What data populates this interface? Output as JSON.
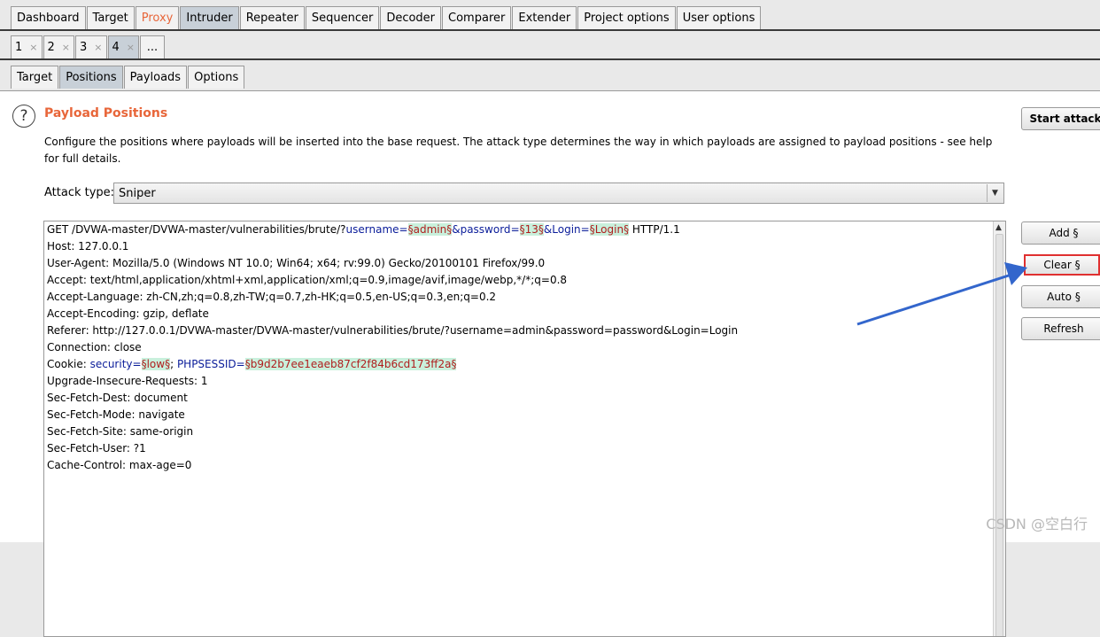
{
  "main_tabs": [
    "Dashboard",
    "Target",
    "Proxy",
    "Intruder",
    "Repeater",
    "Sequencer",
    "Decoder",
    "Comparer",
    "Extender",
    "Project options",
    "User options"
  ],
  "sub_tabs": [
    {
      "label": "1",
      "close": "×"
    },
    {
      "label": "2",
      "close": "×"
    },
    {
      "label": "3",
      "close": "×"
    },
    {
      "label": "4",
      "close": "×"
    }
  ],
  "sub_more": "...",
  "tool_tabs": [
    "Target",
    "Positions",
    "Payloads",
    "Options"
  ],
  "panel": {
    "title": "Payload Positions",
    "help": "?",
    "description": "Configure the positions where payloads will be inserted into the base request. The attack type determines the way in which payloads are assigned to payload positions - see help for full details.",
    "attack_label": "Attack type:",
    "attack_value": "Sniper",
    "dropdown_arrow": "▼"
  },
  "buttons": {
    "start": "Start attack",
    "add": "Add §",
    "clear": "Clear §",
    "auto": "Auto §",
    "refresh": "Refresh"
  },
  "request": {
    "line1": {
      "p1": "GET /DVWA-master/DVWA-master/vulnerabilities/brute/?",
      "k1": "username",
      "e1": "=",
      "m1": "§admin§",
      "amp1": "&",
      "k2": "password",
      "e2": "=",
      "m2": "§13§",
      "amp2": "&",
      "k3": "Login",
      "e3": "=",
      "m3": "§Login§",
      "tail": " HTTP/1.1"
    },
    "host": "Host: 127.0.0.1",
    "user_agent": "User-Agent: Mozilla/5.0 (Windows NT 10.0; Win64; x64; rv:99.0) Gecko/20100101 Firefox/99.0",
    "accept": "Accept: text/html,application/xhtml+xml,application/xml;q=0.9,image/avif,image/webp,*/*;q=0.8",
    "accept_language": "Accept-Language: zh-CN,zh;q=0.8,zh-TW;q=0.7,zh-HK;q=0.5,en-US;q=0.3,en;q=0.2",
    "accept_encoding": "Accept-Encoding: gzip, deflate",
    "referer": "Referer: http://127.0.0.1/DVWA-master/DVWA-master/vulnerabilities/brute/?username=admin&password=password&Login=Login",
    "connection": "Connection: close",
    "cookie": {
      "prefix": "Cookie: ",
      "k1": "security",
      "e1": "=",
      "m1": "§low§",
      "sep": "; ",
      "k2": "PHPSESSID",
      "e2": "=",
      "m2": "§b9d2b7ee1eaeb87cf2f84b6cd173ff2a§"
    },
    "upgrade": "Upgrade-Insecure-Requests: 1",
    "sec_dest": "Sec-Fetch-Dest: document",
    "sec_mode": "Sec-Fetch-Mode: navigate",
    "sec_site": "Sec-Fetch-Site: same-origin",
    "sec_user": "Sec-Fetch-User: ?1",
    "cache": "Cache-Control: max-age=0"
  },
  "scroll_up": "▲",
  "watermark": "CSDN @空白行",
  "colors": {
    "accent": "#e8663a",
    "highlight_box": "#e03030",
    "arrow": "#3366cc"
  }
}
